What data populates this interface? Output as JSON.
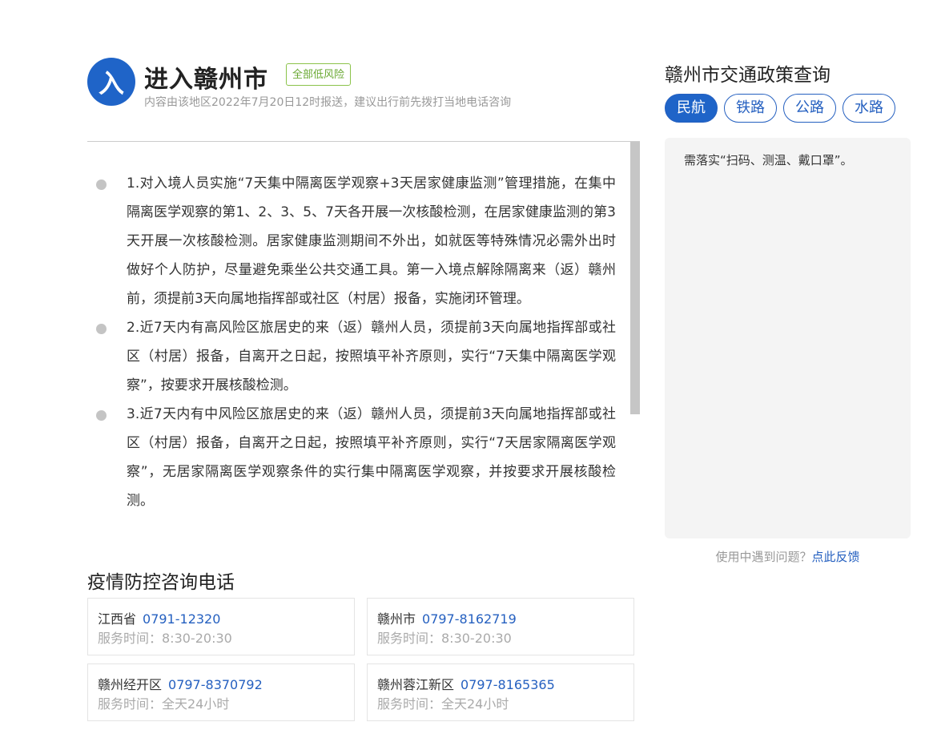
{
  "header": {
    "icon_char": "入",
    "title": "进入赣州市",
    "risk_badge": "全部低风险",
    "subtitle": "内容由该地区2022年7月20日12时报送，建议出行前先拨打当地电话咨询"
  },
  "policies": [
    "1.对入境人员实施“7天集中隔离医学观察+3天居家健康监测”管理措施，在集中隔离医学观察的第1、2、3、5、7天各开展一次核酸检测，在居家健康监测的第3天开展一次核酸检测。居家健康监测期间不外出，如就医等特殊情况必需外出时做好个人防护，尽量避免乘坐公共交通工具。第一入境点解除隔离来（返）赣州前，须提前3天向属地指挥部或社区（村居）报备，实施闭环管理。",
    "2.近7天内有高风险区旅居史的来（返）赣州人员，须提前3天向属地指挥部或社区（村居）报备，自离开之日起，按照填平补齐原则，实行“7天集中隔离医学观察”，按要求开展核酸检测。",
    "3.近7天内有中风险区旅居史的来（返）赣州人员，须提前3天向属地指挥部或社区（村居）报备，自离开之日起，按照填平补齐原则，实行“7天居家隔离医学观察”，无居家隔离医学观察条件的实行集中隔离医学观察，并按要求开展核酸检测。"
  ],
  "hotline": {
    "title": "疫情防控咨询电话",
    "cards": [
      {
        "region": "江西省",
        "phone": "0791-12320",
        "hours": "服务时间：8:30-20:30"
      },
      {
        "region": "赣州市",
        "phone": "0797-8162719",
        "hours": "服务时间：8:30-20:30"
      },
      {
        "region": "赣州经开区",
        "phone": "0797-8370792",
        "hours": "服务时间：全天24小时"
      },
      {
        "region": "赣州蓉江新区",
        "phone": "0797-8165365",
        "hours": "服务时间：全天24小时"
      }
    ]
  },
  "traffic": {
    "title": "赣州市交通政策查询",
    "tabs": [
      "民航",
      "铁路",
      "公路",
      "水路"
    ],
    "active_tab": "民航",
    "content": "需落实“扫码、测温、戴口罩”。"
  },
  "feedback": {
    "prefix": "使用中遇到问题？",
    "link": "点此反馈"
  },
  "colors": {
    "brand_blue": "#1f64c8",
    "link_blue": "#2560c0",
    "risk_green": "#69a832"
  }
}
